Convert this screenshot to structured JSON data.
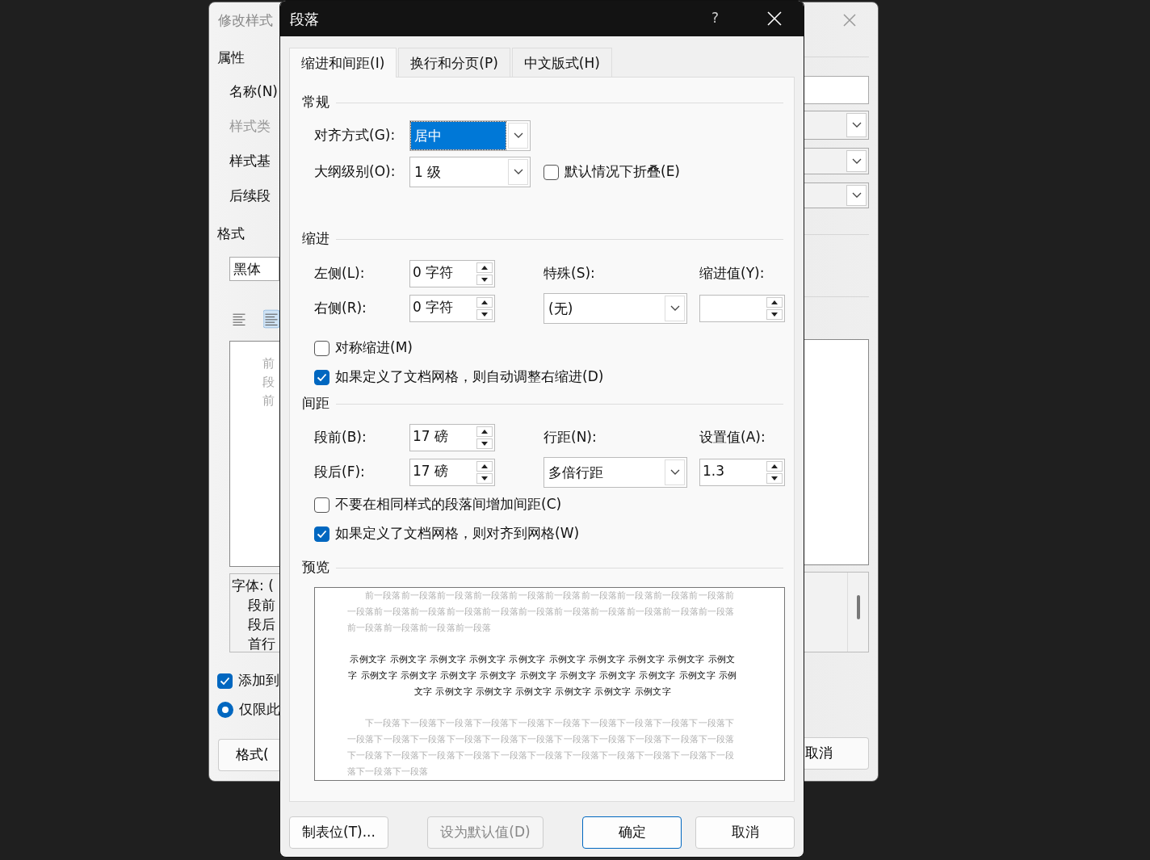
{
  "background_window": {
    "title": "修改样式",
    "properties_heading": "属性",
    "fields": [
      {
        "label": "名称(N)",
        "disabled": false,
        "kind": "text"
      },
      {
        "label": "样式类",
        "disabled": true,
        "kind": "dropdown"
      },
      {
        "label": "样式基",
        "disabled": false,
        "kind": "dropdown"
      },
      {
        "label": "后续段",
        "disabled": false,
        "kind": "dropdown"
      }
    ],
    "format_heading": "格式",
    "font_value": "黑体",
    "align_buttons": [
      {
        "selected": false
      },
      {
        "selected": true
      }
    ],
    "preview_lines": [
      "前",
      "段",
      "前"
    ],
    "description_lines": [
      "字体: (",
      "段前",
      "段后",
      "首行"
    ],
    "add_checkbox": {
      "label": "添加到",
      "checked": true
    },
    "scope_radio": {
      "label": "仅限此",
      "selected": true
    },
    "format_button": "格式(",
    "cancel_button": "取消"
  },
  "dialog": {
    "title": "段落",
    "help": "?",
    "tabs": [
      {
        "label": "缩进和间距(I)",
        "selected": true
      },
      {
        "label": "换行和分页(P)",
        "selected": false
      },
      {
        "label": "中文版式(H)",
        "selected": false
      }
    ],
    "general": {
      "heading": "常规",
      "alignment": {
        "label": "对齐方式(G):",
        "value": "居中",
        "highlighted": true
      },
      "outline": {
        "label": "大纲级别(O):",
        "value": "1 级",
        "highlighted": false
      },
      "collapse": {
        "label": "默认情况下折叠(E)",
        "checked": false
      }
    },
    "indent": {
      "heading": "缩进",
      "left": {
        "label": "左侧(L):",
        "value": "0 字符"
      },
      "right": {
        "label": "右侧(R):",
        "value": "0 字符"
      },
      "special": {
        "label": "特殊(S):",
        "value": "(无)"
      },
      "by": {
        "label": "缩进值(Y):"
      },
      "options": [
        {
          "label": "对称缩进(M)",
          "checked": false
        },
        {
          "label": "如果定义了文档网格，则自动调整右缩进(D)",
          "checked": true
        }
      ]
    },
    "spacing": {
      "heading": "间距",
      "before": {
        "label": "段前(B):",
        "value": "17 磅"
      },
      "after": {
        "label": "段后(F):",
        "value": "17 磅"
      },
      "line_spacing": {
        "label": "行距(N):",
        "value": "多倍行距"
      },
      "at": {
        "label": "设置值(A):",
        "value": "1.3"
      },
      "options": [
        {
          "label": "不要在相同样式的段落间增加间距(C)",
          "checked": false
        },
        {
          "label": "如果定义了文档网格，则对齐到网格(W)",
          "checked": true
        }
      ]
    },
    "preview": {
      "heading": "预览",
      "previous": "前一段落前一段落前一段落前一段落前一段落前一段落前一段落前一段落前一段落前一段落前一段落前一段落前一段落前一段落前一段落前一段落前一段落前一段落前一段落前一段落前一段落前一段落前一段落前一段落前一段落",
      "sample": "示例文字 示例文字 示例文字 示例文字 示例文字 示例文字 示例文字 示例文字 示例文字 示例文字 示例文字 示例文字 示例文字 示例文字 示例文字 示例文字 示例文字 示例文字 示例文字 示例文字 示例文字 示例文字 示例文字 示例文字 示例文字 示例文字",
      "next": "下一段落下一段落下一段落下一段落下一段落下一段落下一段落下一段落下一段落下一段落下一段落下一段落下一段落下一段落下一段落下一段落下一段落下一段落下一段落下一段落下一段落下一段落下一段落下一段落下一段落下一段落下一段落下一段落下一段落下一段落下一段落下一段落下一段落下一段落"
    },
    "buttons": [
      {
        "label": "制表位(T)...",
        "disabled": false,
        "default": false
      },
      {
        "label": "设为默认值(D)",
        "disabled": true,
        "default": false
      },
      {
        "label": "确定",
        "disabled": false,
        "default": true
      },
      {
        "label": "取消",
        "disabled": false,
        "default": false
      }
    ]
  }
}
